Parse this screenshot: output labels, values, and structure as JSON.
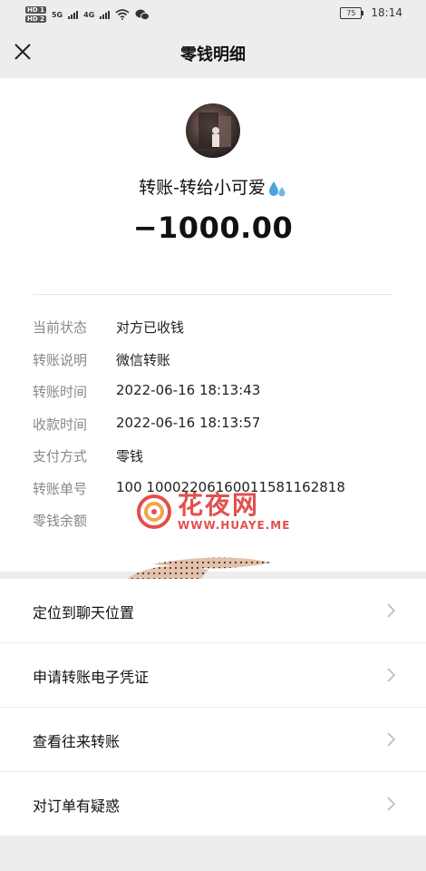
{
  "status_bar": {
    "hd1": "HD 1",
    "hd2": "HD 2",
    "net1": "5G",
    "net2": "4G",
    "battery": "75",
    "time": "18:14"
  },
  "nav": {
    "title": "零钱明细",
    "close_icon": "close-icon"
  },
  "transfer": {
    "title": "转账-转给小可爱",
    "emoji_icon": "sweat-droplets-icon",
    "amount": "−1000.00"
  },
  "details": [
    {
      "label": "当前状态",
      "value": "对方已收钱"
    },
    {
      "label": "转账说明",
      "value": "微信转账"
    },
    {
      "label": "转账时间",
      "value": "2022-06-16 18:13:43"
    },
    {
      "label": "收款时间",
      "value": "2022-06-16 18:13:57"
    },
    {
      "label": "支付方式",
      "value": "零钱"
    },
    {
      "label": "转账单号",
      "value": "100       10002206160011581162818"
    },
    {
      "label": "零钱余额",
      "value": ""
    }
  ],
  "watermark": {
    "cn": "花夜网",
    "en": "WWW.HUAYE.ME"
  },
  "actions": [
    {
      "label": "定位到聊天位置"
    },
    {
      "label": "申请转账电子凭证"
    },
    {
      "label": "查看往来转账"
    },
    {
      "label": "对订单有疑惑"
    }
  ],
  "colors": {
    "background": "#ededed",
    "card": "#ffffff",
    "label_gray": "#888888",
    "watermark_red": "#e2504d"
  }
}
